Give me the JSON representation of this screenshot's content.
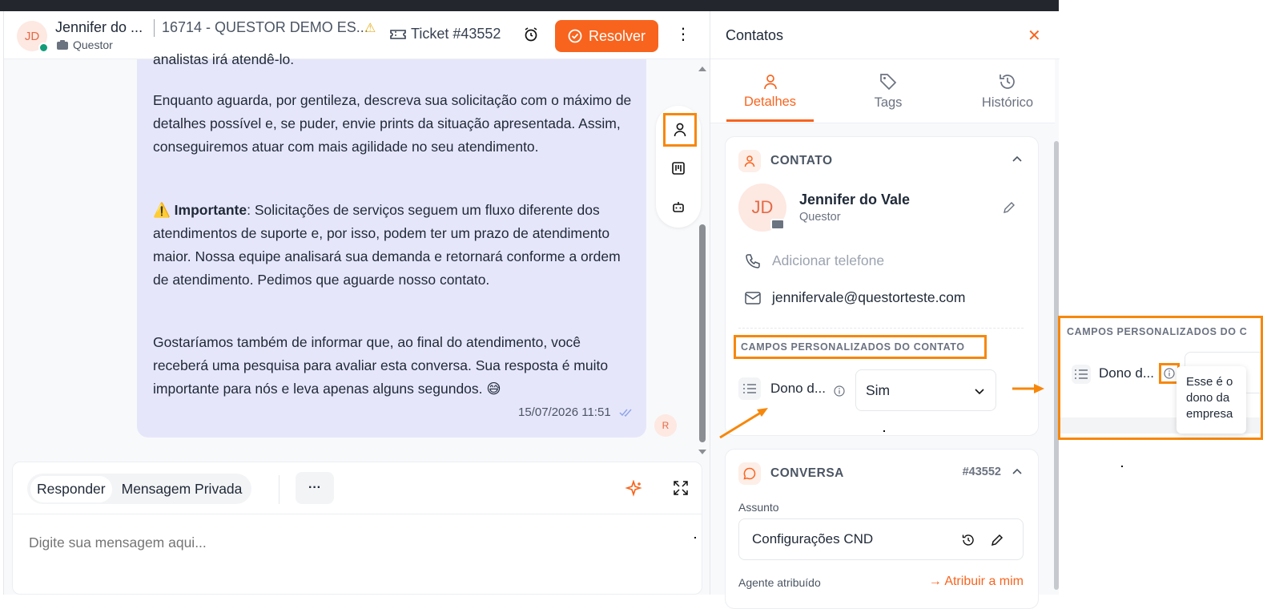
{
  "header": {
    "avatar_initials": "JD",
    "contact_name": "Jennifer do ...",
    "org_title": "16714 - QUESTOR DEMO ES...",
    "company": "Questor",
    "ticket_label": "Ticket #43552",
    "resolve_label": "Resolver"
  },
  "chat": {
    "messages": {
      "p0": "analistas irá atendê-lo.",
      "p1": "Enquanto aguarda, por gentileza, descreva sua solicitação com o máximo de detalhes possível e, se puder, envie prints da situação apresentada. Assim, conseguiremos atuar com mais agilidade no seu atendimento.",
      "p2_bold": "Importante",
      "p2_rest": ": Solicitações de serviços seguem um fluxo diferente dos atendimentos de suporte e, por isso, podem ter um prazo de atendimento maior. Nossa equipe analisará sua demanda e retornará conforme a ordem de atendimento. Pedimos que aguarde nosso contato.",
      "p3": "Gostaríamos também de informar que, ao final do atendimento, você receberá uma pesquisa para avaliar esta conversa. Sua resposta é muito importante para nós e leva apenas alguns segundos. 😅"
    },
    "timestamp": "15/07/2026 11:51",
    "sender_badge": "R"
  },
  "composer": {
    "tab_reply": "Responder",
    "tab_private": "Mensagem Privada",
    "more": "···",
    "placeholder": "Digite sua mensagem aqui..."
  },
  "panel": {
    "title": "Contatos",
    "tabs": [
      {
        "label": "Detalhes",
        "icon": "user-icon",
        "active": true
      },
      {
        "label": "Tags",
        "icon": "tag-icon",
        "active": false
      },
      {
        "label": "Histórico",
        "icon": "history-icon",
        "active": false
      }
    ],
    "contact_card": {
      "heading": "CONTATO",
      "initials": "JD",
      "name": "Jennifer do Vale",
      "company": "Questor",
      "phone_placeholder": "Adicionar telefone",
      "email": "jennifervale@questorteste.com",
      "custom_fields_heading": "CAMPOS PERSONALIZADOS DO CONTATO",
      "custom_field_name": "Dono d...",
      "custom_field_value": "Sim"
    },
    "conversation_card": {
      "heading": "CONVERSA",
      "number": "#43552",
      "subject_label": "Assunto",
      "subject_value": "Configurações CND",
      "agent_label": "Agente atribuído",
      "assign_me": "→ Atribuir a mim"
    }
  },
  "zoom_callout": {
    "heading": "CAMPOS PERSONALIZADOS DO C",
    "field_name": "Dono d...",
    "tooltip": "Esse é o dono da empresa"
  },
  "colors": {
    "accent": "#f8641e",
    "highlight_box": "#f7870b",
    "message_bg": "#e6e6fb",
    "online": "#139c7a"
  }
}
